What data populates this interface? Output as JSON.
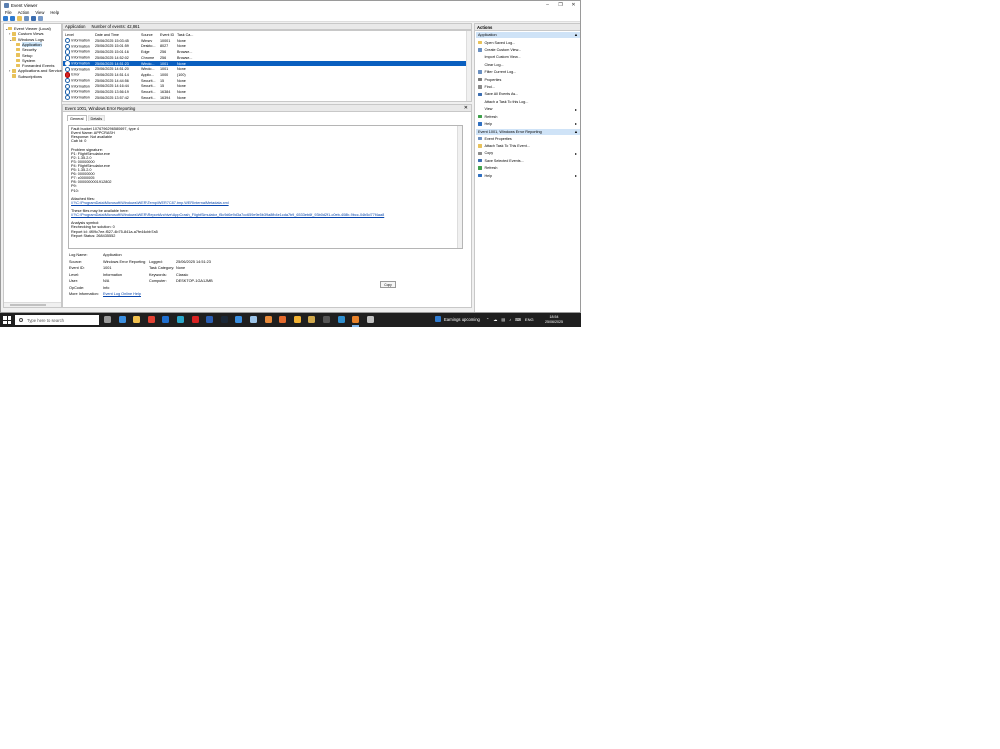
{
  "window": {
    "title": "Event Viewer",
    "minimize": "–",
    "maximize": "❐",
    "close": "✕"
  },
  "menu": [
    "File",
    "Action",
    "View",
    "Help"
  ],
  "tree": {
    "items": [
      {
        "label": "Event Viewer (Local)",
        "indent": 0,
        "expander": "⌄"
      },
      {
        "label": "Custom Views",
        "indent": 1,
        "expander": "›"
      },
      {
        "label": "Windows Logs",
        "indent": 1,
        "expander": "⌄"
      },
      {
        "label": "Application",
        "indent": 2,
        "expander": "",
        "selected": true
      },
      {
        "label": "Security",
        "indent": 2,
        "expander": ""
      },
      {
        "label": "Setup",
        "indent": 2,
        "expander": ""
      },
      {
        "label": "System",
        "indent": 2,
        "expander": ""
      },
      {
        "label": "Forwarded Events",
        "indent": 2,
        "expander": ""
      },
      {
        "label": "Applications and Services Lo",
        "indent": 1,
        "expander": "›"
      },
      {
        "label": "Subscriptions",
        "indent": 1,
        "expander": ""
      }
    ]
  },
  "center": {
    "log_name": "Application",
    "event_count": "Number of events: 42,861",
    "columns": [
      "Level",
      "Date and Time",
      "Source",
      "Event ID",
      "Task Ca..."
    ],
    "rows": [
      {
        "level": "Information",
        "date": "25/06/2025 15:03:45",
        "source": "Winsrv",
        "id": "10001",
        "task": "None",
        "error": false
      },
      {
        "level": "Information",
        "date": "25/06/2025 15:01:59",
        "source": "Deskto...",
        "id": "8027",
        "task": "None",
        "error": false
      },
      {
        "level": "Information",
        "date": "25/06/2025 15:01:16",
        "source": "Edge",
        "id": "256",
        "task": "Browse...",
        "error": false
      },
      {
        "level": "Information",
        "date": "25/06/2025 14:52:02",
        "source": "Chrome",
        "id": "256",
        "task": "Browse...",
        "error": false
      },
      {
        "level": "Information",
        "date": "25/06/2025 14:51:23",
        "source": "Windo...",
        "id": "1001",
        "task": "None",
        "error": false,
        "selected": true
      },
      {
        "level": "Information",
        "date": "25/06/2025 14:51:20",
        "source": "Windo...",
        "id": "1001",
        "task": "None",
        "error": false
      },
      {
        "level": "Error",
        "date": "25/06/2025 14:51:14",
        "source": "Applic...",
        "id": "1000",
        "task": "(100)",
        "error": true
      },
      {
        "level": "Information",
        "date": "25/06/2025 14:44:56",
        "source": "Securit...",
        "id": "15",
        "task": "None",
        "error": false
      },
      {
        "level": "Information",
        "date": "25/06/2025 14:16:44",
        "source": "Securit...",
        "id": "15",
        "task": "None",
        "error": false
      },
      {
        "level": "Information",
        "date": "25/06/2025 13:56:19",
        "source": "Securit...",
        "id": "16384",
        "task": "None",
        "error": false
      },
      {
        "level": "Information",
        "date": "25/06/2025 13:57:42",
        "source": "Securit...",
        "id": "16394",
        "task": "None",
        "error": false
      }
    ]
  },
  "detail": {
    "title": "Event 1001, Windows Error Reporting",
    "close": "✕",
    "tabs": [
      "General",
      "Details"
    ],
    "lines": [
      {
        "text": "Fault bucket 1076796296580697, type 4",
        "link": false
      },
      {
        "text": "Event Name: APPCRASH",
        "link": false
      },
      {
        "text": "Response: Not available",
        "link": false
      },
      {
        "text": "Cab Id: 0",
        "link": false
      },
      {
        "text": "",
        "link": false
      },
      {
        "text": "Problem signature:",
        "link": false
      },
      {
        "text": "P1: FlightSimulator.exe",
        "link": false
      },
      {
        "text": "P2: 1.35.2.0",
        "link": false
      },
      {
        "text": "P3: 00000000",
        "link": false
      },
      {
        "text": "P4: FlightSimulator.exe",
        "link": false
      },
      {
        "text": "P5: 1.35.2.0",
        "link": false
      },
      {
        "text": "P6: 00000000",
        "link": false
      },
      {
        "text": "P7: c0000005",
        "link": false
      },
      {
        "text": "P8: 0000000001912802",
        "link": false
      },
      {
        "text": "P9:",
        "link": false
      },
      {
        "text": "P10:",
        "link": false
      },
      {
        "text": "",
        "link": false
      },
      {
        "text": "Attached files:",
        "link": false
      },
      {
        "text": "\\\\?\\C:\\ProgramData\\Microsoft\\Windows\\WER\\Temp\\WER7C87.tmp.WERInternalMetadata.xml",
        "link": true
      },
      {
        "text": "",
        "link": false
      },
      {
        "text": "These files may be available here:",
        "link": false
      },
      {
        "text": "\\\\?\\C:\\ProgramData\\Microsoft\\Windows\\WER\\ReportArchive\\AppCrash_FlightSimulator_f5c9d6e9d3a7cc659e9e5b39a8fb4e1cda7b9_6533eb6f_93b0d2f1-c0eb-408b-9bcc-04b5d77f4aa8",
        "link": true
      },
      {
        "text": "",
        "link": false
      },
      {
        "text": "Analysis symbol:",
        "link": false
      },
      {
        "text": "Rechecking for solution: 0",
        "link": false
      },
      {
        "text": "Report Id: 4f09c7ee-f527-4b75-841a-a7fe44cbb7a5",
        "link": false
      },
      {
        "text": "Report Status: 268435552",
        "link": false
      }
    ],
    "props": {
      "log_name_label": "Log Name:",
      "log_name": "Application",
      "source_label": "Source:",
      "source": "Windows Error Reporting",
      "logged_label": "Logged:",
      "logged": "25/06/2025 14:51:23",
      "event_id_label": "Event ID:",
      "event_id": "1001",
      "task_label": "Task Category:",
      "task": "None",
      "level_label": "Level:",
      "level": "Information",
      "keywords_label": "Keywords:",
      "keywords": "Classic",
      "user_label": "User:",
      "user": "N/A",
      "computer_label": "Computer:",
      "computer": "DESKTOP-1GA1JMB",
      "opcode_label": "OpCode:",
      "opcode": "Info",
      "more_info_label": "More Information:",
      "more_info": "Event Log Online Help"
    },
    "copy_button": "Copy"
  },
  "actions": {
    "header": "Actions",
    "section1": "Application",
    "items1": [
      {
        "label": "Open Saved Log...",
        "arrow": "",
        "color": "#e8c25a"
      },
      {
        "label": "Create Custom View...",
        "arrow": "",
        "color": "#6a8fc0"
      },
      {
        "label": "Import Custom View...",
        "arrow": "",
        "color": "#ffffff"
      },
      {
        "label": "Clear Log...",
        "arrow": "",
        "color": "#ffffff"
      },
      {
        "label": "Filter Current Log...",
        "arrow": "",
        "color": "#6a8fc0"
      },
      {
        "label": "Properties",
        "arrow": "",
        "color": "#7a7a7a"
      },
      {
        "label": "Find...",
        "arrow": "",
        "color": "#8a8a8a"
      },
      {
        "label": "Save All Events As...",
        "arrow": "",
        "color": "#3b6db0"
      },
      {
        "label": "Attach a Task To this Log...",
        "arrow": "",
        "color": "#ffffff"
      },
      {
        "label": "View",
        "arrow": "▸",
        "color": "#ffffff"
      },
      {
        "label": "Refresh",
        "arrow": "",
        "color": "#3ea04a"
      },
      {
        "label": "Help",
        "arrow": "▸",
        "color": "#2f6fc0"
      }
    ],
    "section2": "Event 1001, Windows Error Reporting",
    "items2": [
      {
        "label": "Event Properties",
        "arrow": "",
        "color": "#6a8fc0"
      },
      {
        "label": "Attach Task To This Event...",
        "arrow": "",
        "color": "#e8c25a"
      },
      {
        "label": "Copy",
        "arrow": "▸",
        "color": "#8a8a8a"
      },
      {
        "label": "Save Selected Events...",
        "arrow": "",
        "color": "#3b6db0"
      },
      {
        "label": "Refresh",
        "arrow": "",
        "color": "#3ea04a"
      },
      {
        "label": "Help",
        "arrow": "▸",
        "color": "#2f6fc0"
      }
    ]
  },
  "taskbar": {
    "search_placeholder": "Type here to search",
    "apps": [
      {
        "name": "task-view",
        "color": "#9a9a9a"
      },
      {
        "name": "mail",
        "color": "#3b8fe0"
      },
      {
        "name": "file-explorer",
        "color": "#f2c14e"
      },
      {
        "name": "chrome",
        "color": "#e34133"
      },
      {
        "name": "outlook",
        "color": "#1f6fd0"
      },
      {
        "name": "edge",
        "color": "#2aa7c9"
      },
      {
        "name": "acrobat",
        "color": "#d92323"
      },
      {
        "name": "word",
        "color": "#2b5fb4"
      },
      {
        "name": "steam",
        "color": "#1b2838"
      },
      {
        "name": "security",
        "color": "#3b8fe0"
      },
      {
        "name": "notepad",
        "color": "#9cc4e8"
      },
      {
        "name": "paint",
        "color": "#e88a3a"
      },
      {
        "name": "brave",
        "color": "#e56a2d"
      },
      {
        "name": "chrome-2",
        "color": "#f2b233"
      },
      {
        "name": "files",
        "color": "#d0a84b"
      },
      {
        "name": "terminal",
        "color": "#555555"
      },
      {
        "name": "media",
        "color": "#2f8fcf"
      },
      {
        "name": "vlc",
        "color": "#e8822a"
      },
      {
        "name": "event-viewer",
        "color": "#c0c0c0"
      }
    ],
    "news": "Earnings upcoming",
    "language": "ENG",
    "time": "18:54",
    "date": "25/06/2025"
  }
}
